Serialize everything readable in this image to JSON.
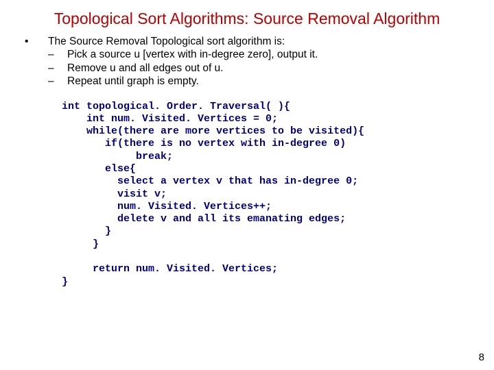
{
  "title": "Topological Sort Algorithms: Source Removal Algorithm",
  "intro": "The Source Removal Topological sort algorithm is:",
  "steps": [
    "Pick a source u [vertex with in-degree zero], output it.",
    "Remove u and all edges out of u.",
    "Repeat until graph is empty."
  ],
  "code": "int topological. Order. Traversal( ){\n    int num. Visited. Vertices = 0;\n    while(there are more vertices to be visited){\n       if(there is no vertex with in-degree 0)\n            break;\n       else{\n         select a vertex v that has in-degree 0;\n         visit v;\n         num. Visited. Vertices++;\n         delete v and all its emanating edges;\n       }\n     }\n\n     return num. Visited. Vertices;\n}",
  "bulletChar": "•",
  "dashChar": "–",
  "pageNumber": "8"
}
